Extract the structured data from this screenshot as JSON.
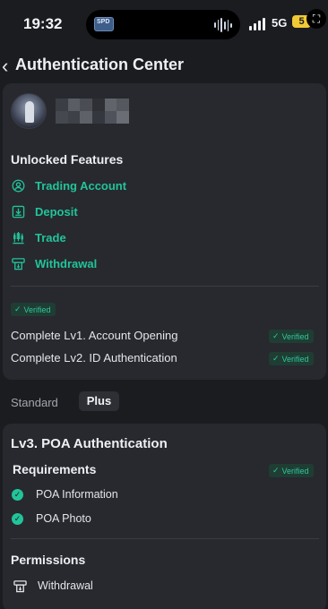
{
  "status_bar": {
    "time": "19:32",
    "network": "5G",
    "battery": "5",
    "island_thumb_text": "SPD"
  },
  "header": {
    "title": "Authentication Center"
  },
  "unlocked": {
    "heading": "Unlocked Features",
    "features": [
      {
        "label": "Trading Account",
        "icon": "user-circle-icon"
      },
      {
        "label": "Deposit",
        "icon": "deposit-icon"
      },
      {
        "label": "Trade",
        "icon": "candlestick-icon"
      },
      {
        "label": "Withdrawal",
        "icon": "withdrawal-icon"
      }
    ]
  },
  "verification": {
    "badge_label": "Verified",
    "rows": [
      {
        "label": "Complete Lv1. Account Opening",
        "status": "Verified"
      },
      {
        "label": "Complete Lv2. ID Authentication",
        "status": "Verified"
      }
    ]
  },
  "tabs": {
    "standard": "Standard",
    "plus": "Plus",
    "active": "plus"
  },
  "lv3": {
    "title": "Lv3. POA Authentication",
    "requirements_heading": "Requirements",
    "requirements_status": "Verified",
    "requirements": [
      "POA Information",
      "POA Photo"
    ],
    "permissions_heading": "Permissions",
    "permissions": [
      {
        "label": "Withdrawal",
        "icon": "withdrawal-icon"
      }
    ]
  },
  "colors": {
    "accent_green": "#22c49a",
    "background": "#1b1c20",
    "card": "#27292f",
    "battery": "#f2c935"
  }
}
